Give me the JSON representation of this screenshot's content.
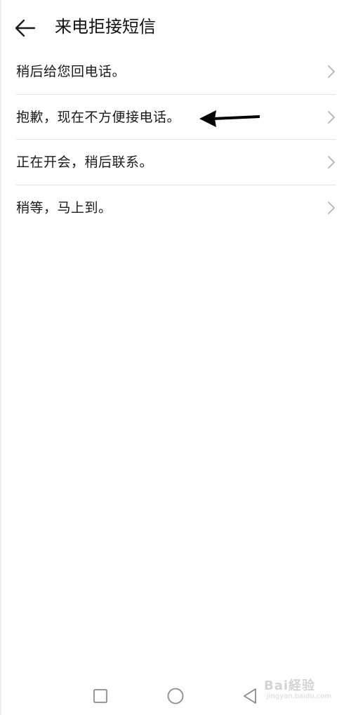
{
  "header": {
    "back_icon": "arrow-left-icon",
    "title": "来电拒接短信"
  },
  "messages": [
    {
      "label": "稍后给您回电话。",
      "icon": "chevron-right-icon"
    },
    {
      "label": "抱歉，现在不方便接电话。",
      "icon": "chevron-right-icon"
    },
    {
      "label": "正在开会，稍后联系。",
      "icon": "chevron-right-icon"
    },
    {
      "label": "稍等，马上到。",
      "icon": "chevron-right-icon"
    }
  ],
  "annotation": {
    "icon": "arrow-left-annotation-icon",
    "color": "#000000"
  },
  "nav_bar": {
    "recents_icon": "square-recents-icon",
    "home_icon": "circle-home-icon",
    "back_icon": "triangle-back-icon"
  },
  "watermark": {
    "text": "Bai経验",
    "url_text": "jingyan.baidu.com"
  },
  "colors": {
    "background": "#ffffff",
    "text": "#1a1a1a",
    "divider": "#e3e3e3",
    "chevron": "#b3b3b3",
    "nav_icon": "#8c8c8c"
  }
}
